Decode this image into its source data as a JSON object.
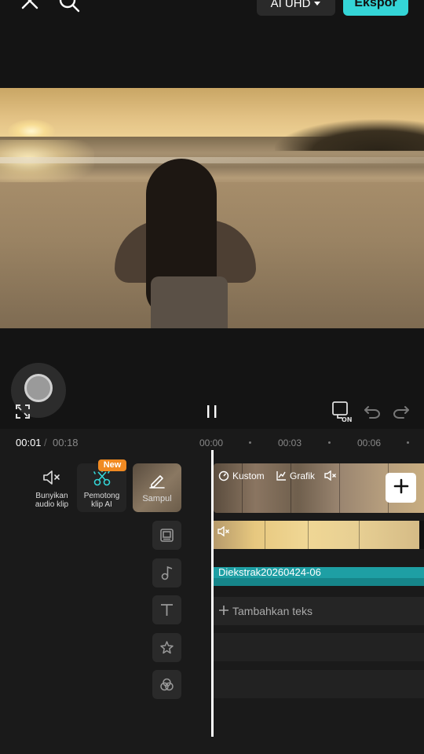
{
  "header": {
    "resolution_label": "AI UHD",
    "export_label": "Ekspor"
  },
  "timecode": {
    "current": "00:01",
    "separator": "/",
    "total": "00:18"
  },
  "ruler": [
    "00:00",
    "00:03",
    "00:06"
  ],
  "tools": {
    "mute_label_1": "Bunyikan",
    "mute_label_2": "audio klip",
    "cutter_label_1": "Pemotong",
    "cutter_label_2": "klip AI",
    "new_badge": "New",
    "cover_label": "Sampul"
  },
  "video_track": {
    "custom_label": "Kustom",
    "graph_label": "Grafik"
  },
  "extract_track": {
    "label": "Diekstrak20260424-06"
  },
  "text_track": {
    "label": "Tambahkan teks"
  },
  "colors": {
    "accent": "#34d5d7",
    "badge": "#f08a22",
    "extract": "#1e9fa4"
  }
}
